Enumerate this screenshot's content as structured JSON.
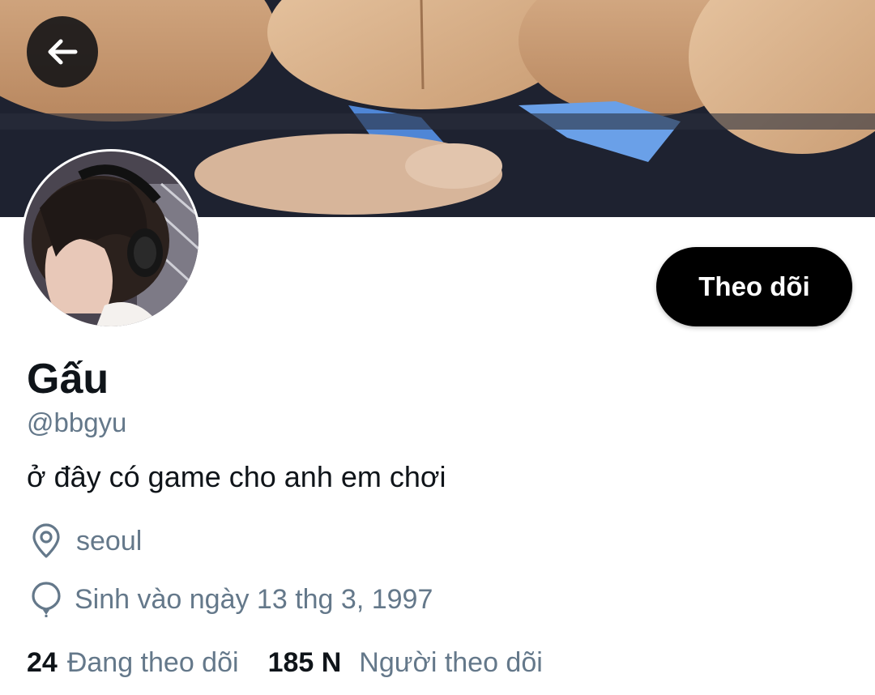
{
  "header": {
    "back_icon": "arrow-left-icon"
  },
  "profile": {
    "display_name": "Gấu",
    "handle": "@bbgyu",
    "bio": "ở đây có game cho anh em chơi",
    "follow_button_label": "Theo dõi",
    "location": "seoul",
    "location_icon": "location-pin-icon",
    "birthday": "Sinh vào ngày 13 thg 3, 1997",
    "birthday_icon": "balloon-icon"
  },
  "stats": {
    "following_count": "24",
    "following_label": "Đang theo dõi",
    "followers_count": "185 N",
    "followers_label": "Người theo dõi"
  },
  "colors": {
    "primary_text": "#0f1419",
    "secondary_text": "#64788a",
    "button_bg": "#000000",
    "button_text": "#ffffff"
  }
}
